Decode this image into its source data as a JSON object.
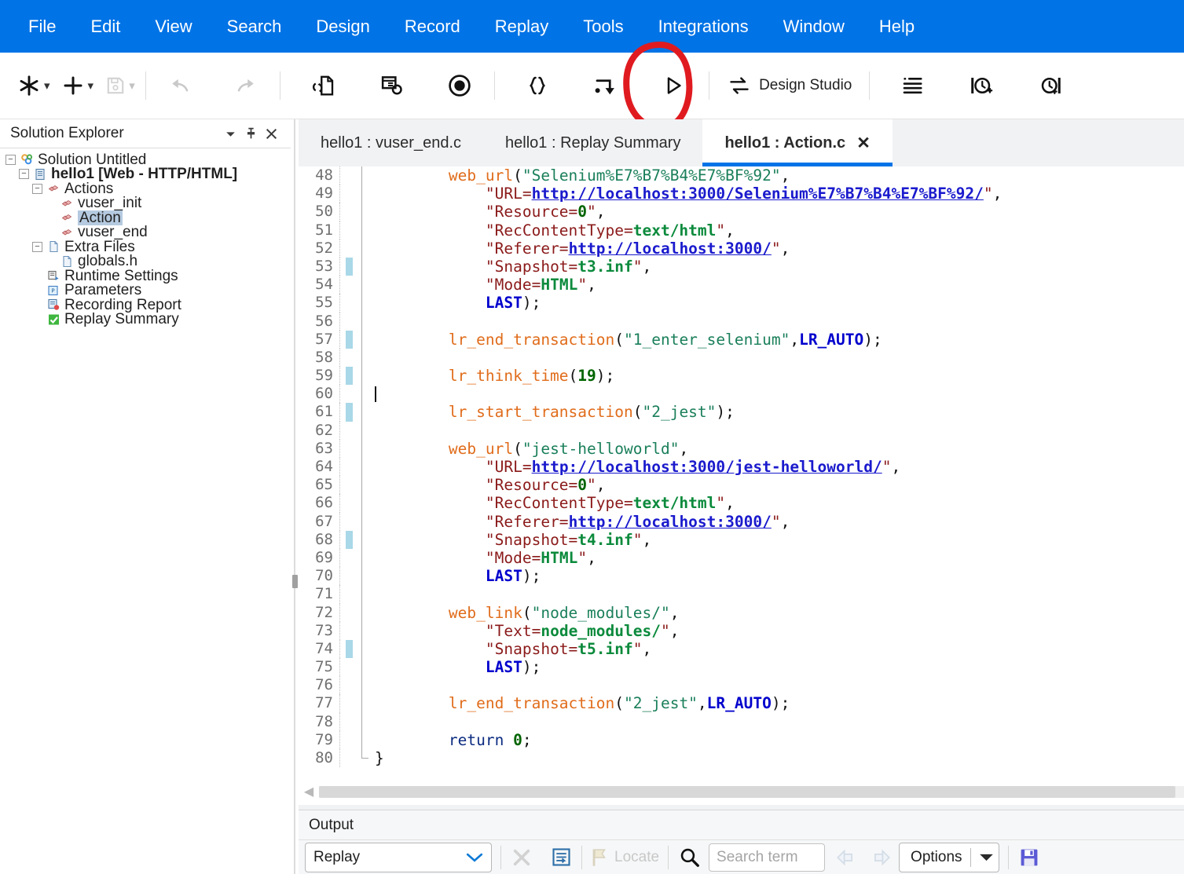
{
  "menu": {
    "items": [
      {
        "label": "File"
      },
      {
        "label": "Edit"
      },
      {
        "label": "View"
      },
      {
        "label": "Search"
      },
      {
        "label": "Design"
      },
      {
        "label": "Record"
      },
      {
        "label": "Replay"
      },
      {
        "label": "Tools"
      },
      {
        "label": "Integrations"
      },
      {
        "label": "Window"
      },
      {
        "label": "Help"
      }
    ],
    "bg_color": "#0073e6"
  },
  "toolbar": {
    "new_icon": "asterisk-new-icon",
    "add_icon": "plus-add-icon",
    "save_icon": "save-disk-icon",
    "undo_icon": "undo-arrow-icon",
    "redo_icon": "redo-arrow-icon",
    "compare_icon": "compare-script-icon",
    "regenerate_icon": "regenerate-script-icon",
    "record_icon": "record-circle-icon",
    "braces_icon": "curly-braces-icon",
    "step_icon": "step-into-icon",
    "replay_icon": "play-replay-icon",
    "design_studio_icon": "design-studio-swap-icon",
    "design_studio_label": "Design Studio",
    "indent_icon": "list-indent-icon",
    "think_start_icon": "think-time-start-icon",
    "think_end_icon": "think-time-end-icon",
    "caret_glyph": "chevron-down-icon"
  },
  "annotation": {
    "shape": "red-ellipse-highlight",
    "color": "#e01b20",
    "target": "play-replay-icon"
  },
  "sidebar": {
    "title": "Solution Explorer",
    "header_buttons": [
      {
        "name": "dropdown-menu-icon",
        "glyph": "▼"
      },
      {
        "name": "pin-icon",
        "glyph": "↑"
      },
      {
        "name": "close-icon",
        "glyph": "✕"
      }
    ],
    "tree": [
      {
        "label": "Solution Untitled",
        "depth": 0,
        "toggle": "minus",
        "icon": "solution-icon",
        "bold": false,
        "selected": false
      },
      {
        "label": "hello1 [Web - HTTP/HTML]",
        "depth": 1,
        "toggle": "minus",
        "icon": "script-icon",
        "bold": true,
        "selected": false
      },
      {
        "label": "Actions",
        "depth": 2,
        "toggle": "minus",
        "icon": "actions-folder-icon",
        "bold": false,
        "selected": false
      },
      {
        "label": "vuser_init",
        "depth": 3,
        "toggle": "none",
        "icon": "action-block-icon",
        "bold": false,
        "selected": false
      },
      {
        "label": "Action",
        "depth": 3,
        "toggle": "none",
        "icon": "action-block-icon",
        "bold": false,
        "selected": true
      },
      {
        "label": "vuser_end",
        "depth": 3,
        "toggle": "none",
        "icon": "action-block-icon",
        "bold": false,
        "selected": false
      },
      {
        "label": "Extra Files",
        "depth": 2,
        "toggle": "minus",
        "icon": "extra-files-icon",
        "bold": false,
        "selected": false
      },
      {
        "label": "globals.h",
        "depth": 3,
        "toggle": "none",
        "icon": "header-file-icon",
        "bold": false,
        "selected": false
      },
      {
        "label": "Runtime Settings",
        "depth": 2,
        "toggle": "none",
        "icon": "runtime-settings-icon",
        "bold": false,
        "selected": false
      },
      {
        "label": "Parameters",
        "depth": 2,
        "toggle": "none",
        "icon": "parameters-icon",
        "bold": false,
        "selected": false
      },
      {
        "label": "Recording Report",
        "depth": 2,
        "toggle": "none",
        "icon": "recording-report-icon",
        "bold": false,
        "selected": false
      },
      {
        "label": "Replay Summary",
        "depth": 2,
        "toggle": "none",
        "icon": "replay-summary-icon",
        "bold": false,
        "selected": false
      }
    ]
  },
  "editor": {
    "tabs": [
      {
        "label": "hello1 : vuser_end.c",
        "active": false,
        "closable": false
      },
      {
        "label": "hello1 : Replay Summary",
        "active": false,
        "closable": false
      },
      {
        "label": "hello1 : Action.c",
        "active": true,
        "closable": true,
        "close_glyph": "✕"
      }
    ],
    "first_line": 48,
    "last_line": 80,
    "cursor_line": 60,
    "lines": [
      {
        "n": 48,
        "changed": false,
        "fold": "line",
        "tokens": [
          {
            "t": "        ",
            "c": "s-plain"
          },
          {
            "t": "web_url",
            "c": "s-fn"
          },
          {
            "t": "(",
            "c": "s-punc"
          },
          {
            "t": "\"Selenium%E7%B7%B4%E7%BF%92\"",
            "c": "s-str"
          },
          {
            "t": ",",
            "c": "s-punc"
          }
        ]
      },
      {
        "n": 49,
        "changed": false,
        "fold": "line",
        "tokens": [
          {
            "t": "            ",
            "c": "s-plain"
          },
          {
            "t": "\"URL=",
            "c": "s-attr"
          },
          {
            "t": "http://localhost:3000/Selenium%E7%B7%B4%E7%BF%92/",
            "c": "s-url"
          },
          {
            "t": "\"",
            "c": "s-attr"
          },
          {
            "t": ",",
            "c": "s-punc"
          }
        ]
      },
      {
        "n": 50,
        "changed": false,
        "fold": "line",
        "tokens": [
          {
            "t": "            ",
            "c": "s-plain"
          },
          {
            "t": "\"Resource=",
            "c": "s-attr"
          },
          {
            "t": "0",
            "c": "s-num"
          },
          {
            "t": "\"",
            "c": "s-attr"
          },
          {
            "t": ",",
            "c": "s-punc"
          }
        ]
      },
      {
        "n": 51,
        "changed": false,
        "fold": "line",
        "tokens": [
          {
            "t": "            ",
            "c": "s-plain"
          },
          {
            "t": "\"RecContentType=",
            "c": "s-attr"
          },
          {
            "t": "text/html",
            "c": "s-val"
          },
          {
            "t": "\"",
            "c": "s-attr"
          },
          {
            "t": ",",
            "c": "s-punc"
          }
        ]
      },
      {
        "n": 52,
        "changed": false,
        "fold": "line",
        "tokens": [
          {
            "t": "            ",
            "c": "s-plain"
          },
          {
            "t": "\"Referer=",
            "c": "s-attr"
          },
          {
            "t": "http://localhost:3000/",
            "c": "s-url"
          },
          {
            "t": "\"",
            "c": "s-attr"
          },
          {
            "t": ",",
            "c": "s-punc"
          }
        ]
      },
      {
        "n": 53,
        "changed": true,
        "fold": "line",
        "tokens": [
          {
            "t": "            ",
            "c": "s-plain"
          },
          {
            "t": "\"Snapshot=",
            "c": "s-attr"
          },
          {
            "t": "t3.inf",
            "c": "s-val"
          },
          {
            "t": "\"",
            "c": "s-attr"
          },
          {
            "t": ",",
            "c": "s-punc"
          }
        ]
      },
      {
        "n": 54,
        "changed": false,
        "fold": "line",
        "tokens": [
          {
            "t": "            ",
            "c": "s-plain"
          },
          {
            "t": "\"Mode=",
            "c": "s-attr"
          },
          {
            "t": "HTML",
            "c": "s-val"
          },
          {
            "t": "\"",
            "c": "s-attr"
          },
          {
            "t": ",",
            "c": "s-punc"
          }
        ]
      },
      {
        "n": 55,
        "changed": false,
        "fold": "line",
        "tokens": [
          {
            "t": "            ",
            "c": "s-plain"
          },
          {
            "t": "LAST",
            "c": "s-kw"
          },
          {
            "t": ");",
            "c": "s-punc"
          }
        ]
      },
      {
        "n": 56,
        "changed": false,
        "fold": "line",
        "tokens": []
      },
      {
        "n": 57,
        "changed": true,
        "fold": "line",
        "tokens": [
          {
            "t": "        ",
            "c": "s-plain"
          },
          {
            "t": "lr_end_transaction",
            "c": "s-fn"
          },
          {
            "t": "(",
            "c": "s-punc"
          },
          {
            "t": "\"1_enter_selenium\"",
            "c": "s-str"
          },
          {
            "t": ",",
            "c": "s-punc"
          },
          {
            "t": "LR_AUTO",
            "c": "s-kw"
          },
          {
            "t": ");",
            "c": "s-punc"
          }
        ]
      },
      {
        "n": 58,
        "changed": false,
        "fold": "line",
        "tokens": []
      },
      {
        "n": 59,
        "changed": true,
        "fold": "line",
        "tokens": [
          {
            "t": "        ",
            "c": "s-plain"
          },
          {
            "t": "lr_think_time",
            "c": "s-fn"
          },
          {
            "t": "(",
            "c": "s-punc"
          },
          {
            "t": "19",
            "c": "s-num"
          },
          {
            "t": ");",
            "c": "s-punc"
          }
        ]
      },
      {
        "n": 60,
        "changed": false,
        "fold": "line",
        "cursor": true,
        "tokens": []
      },
      {
        "n": 61,
        "changed": true,
        "fold": "line",
        "tokens": [
          {
            "t": "        ",
            "c": "s-plain"
          },
          {
            "t": "lr_start_transaction",
            "c": "s-fn"
          },
          {
            "t": "(",
            "c": "s-punc"
          },
          {
            "t": "\"2_jest\"",
            "c": "s-str"
          },
          {
            "t": ");",
            "c": "s-punc"
          }
        ]
      },
      {
        "n": 62,
        "changed": false,
        "fold": "line",
        "tokens": []
      },
      {
        "n": 63,
        "changed": false,
        "fold": "line",
        "tokens": [
          {
            "t": "        ",
            "c": "s-plain"
          },
          {
            "t": "web_url",
            "c": "s-fn"
          },
          {
            "t": "(",
            "c": "s-punc"
          },
          {
            "t": "\"jest-helloworld\"",
            "c": "s-str"
          },
          {
            "t": ",",
            "c": "s-punc"
          }
        ]
      },
      {
        "n": 64,
        "changed": false,
        "fold": "line",
        "tokens": [
          {
            "t": "            ",
            "c": "s-plain"
          },
          {
            "t": "\"URL=",
            "c": "s-attr"
          },
          {
            "t": "http://localhost:3000/jest-helloworld/",
            "c": "s-url"
          },
          {
            "t": "\"",
            "c": "s-attr"
          },
          {
            "t": ",",
            "c": "s-punc"
          }
        ]
      },
      {
        "n": 65,
        "changed": false,
        "fold": "line",
        "tokens": [
          {
            "t": "            ",
            "c": "s-plain"
          },
          {
            "t": "\"Resource=",
            "c": "s-attr"
          },
          {
            "t": "0",
            "c": "s-num"
          },
          {
            "t": "\"",
            "c": "s-attr"
          },
          {
            "t": ",",
            "c": "s-punc"
          }
        ]
      },
      {
        "n": 66,
        "changed": false,
        "fold": "line",
        "tokens": [
          {
            "t": "            ",
            "c": "s-plain"
          },
          {
            "t": "\"RecContentType=",
            "c": "s-attr"
          },
          {
            "t": "text/html",
            "c": "s-val"
          },
          {
            "t": "\"",
            "c": "s-attr"
          },
          {
            "t": ",",
            "c": "s-punc"
          }
        ]
      },
      {
        "n": 67,
        "changed": false,
        "fold": "line",
        "tokens": [
          {
            "t": "            ",
            "c": "s-plain"
          },
          {
            "t": "\"Referer=",
            "c": "s-attr"
          },
          {
            "t": "http://localhost:3000/",
            "c": "s-url"
          },
          {
            "t": "\"",
            "c": "s-attr"
          },
          {
            "t": ",",
            "c": "s-punc"
          }
        ]
      },
      {
        "n": 68,
        "changed": true,
        "fold": "line",
        "tokens": [
          {
            "t": "            ",
            "c": "s-plain"
          },
          {
            "t": "\"Snapshot=",
            "c": "s-attr"
          },
          {
            "t": "t4.inf",
            "c": "s-val"
          },
          {
            "t": "\"",
            "c": "s-attr"
          },
          {
            "t": ",",
            "c": "s-punc"
          }
        ]
      },
      {
        "n": 69,
        "changed": false,
        "fold": "line",
        "tokens": [
          {
            "t": "            ",
            "c": "s-plain"
          },
          {
            "t": "\"Mode=",
            "c": "s-attr"
          },
          {
            "t": "HTML",
            "c": "s-val"
          },
          {
            "t": "\"",
            "c": "s-attr"
          },
          {
            "t": ",",
            "c": "s-punc"
          }
        ]
      },
      {
        "n": 70,
        "changed": false,
        "fold": "line",
        "tokens": [
          {
            "t": "            ",
            "c": "s-plain"
          },
          {
            "t": "LAST",
            "c": "s-kw"
          },
          {
            "t": ");",
            "c": "s-punc"
          }
        ]
      },
      {
        "n": 71,
        "changed": false,
        "fold": "line",
        "tokens": []
      },
      {
        "n": 72,
        "changed": false,
        "fold": "line",
        "tokens": [
          {
            "t": "        ",
            "c": "s-plain"
          },
          {
            "t": "web_link",
            "c": "s-fn"
          },
          {
            "t": "(",
            "c": "s-punc"
          },
          {
            "t": "\"node_modules/\"",
            "c": "s-str"
          },
          {
            "t": ",",
            "c": "s-punc"
          }
        ]
      },
      {
        "n": 73,
        "changed": false,
        "fold": "line",
        "tokens": [
          {
            "t": "            ",
            "c": "s-plain"
          },
          {
            "t": "\"Text=",
            "c": "s-attr"
          },
          {
            "t": "node_modules/",
            "c": "s-val"
          },
          {
            "t": "\"",
            "c": "s-attr"
          },
          {
            "t": ",",
            "c": "s-punc"
          }
        ]
      },
      {
        "n": 74,
        "changed": true,
        "fold": "line",
        "tokens": [
          {
            "t": "            ",
            "c": "s-plain"
          },
          {
            "t": "\"Snapshot=",
            "c": "s-attr"
          },
          {
            "t": "t5.inf",
            "c": "s-val"
          },
          {
            "t": "\"",
            "c": "s-attr"
          },
          {
            "t": ",",
            "c": "s-punc"
          }
        ]
      },
      {
        "n": 75,
        "changed": false,
        "fold": "line",
        "tokens": [
          {
            "t": "            ",
            "c": "s-plain"
          },
          {
            "t": "LAST",
            "c": "s-kw"
          },
          {
            "t": ");",
            "c": "s-punc"
          }
        ]
      },
      {
        "n": 76,
        "changed": false,
        "fold": "line",
        "tokens": []
      },
      {
        "n": 77,
        "changed": false,
        "fold": "line",
        "tokens": [
          {
            "t": "        ",
            "c": "s-plain"
          },
          {
            "t": "lr_end_transaction",
            "c": "s-fn"
          },
          {
            "t": "(",
            "c": "s-punc"
          },
          {
            "t": "\"2_jest\"",
            "c": "s-str"
          },
          {
            "t": ",",
            "c": "s-punc"
          },
          {
            "t": "LR_AUTO",
            "c": "s-kw"
          },
          {
            "t": ");",
            "c": "s-punc"
          }
        ]
      },
      {
        "n": 78,
        "changed": false,
        "fold": "line",
        "tokens": []
      },
      {
        "n": 79,
        "changed": false,
        "fold": "line",
        "tokens": [
          {
            "t": "        ",
            "c": "s-plain"
          },
          {
            "t": "return",
            "c": "s-ret"
          },
          {
            "t": " ",
            "c": "s-plain"
          },
          {
            "t": "0",
            "c": "s-num"
          },
          {
            "t": ";",
            "c": "s-punc"
          }
        ]
      },
      {
        "n": 80,
        "changed": false,
        "fold": "end",
        "tokens": [
          {
            "t": "}",
            "c": "s-punc"
          }
        ]
      }
    ]
  },
  "output": {
    "title": "Output",
    "source_select": {
      "value": "Replay",
      "caret": "chevron-down-icon"
    },
    "clear_icon": "clear-x-icon",
    "wrap_icon": "word-wrap-icon",
    "locate_icon": "locate-flag-icon",
    "locate_label": "Locate",
    "find_icon": "magnifier-search-icon",
    "search_placeholder": "Search term",
    "search_value": "",
    "prev_icon": "previous-arrow-icon",
    "next_icon": "next-arrow-icon",
    "options_label": "Options",
    "options_caret": "chevron-down-icon",
    "save_icon": "save-output-icon"
  }
}
